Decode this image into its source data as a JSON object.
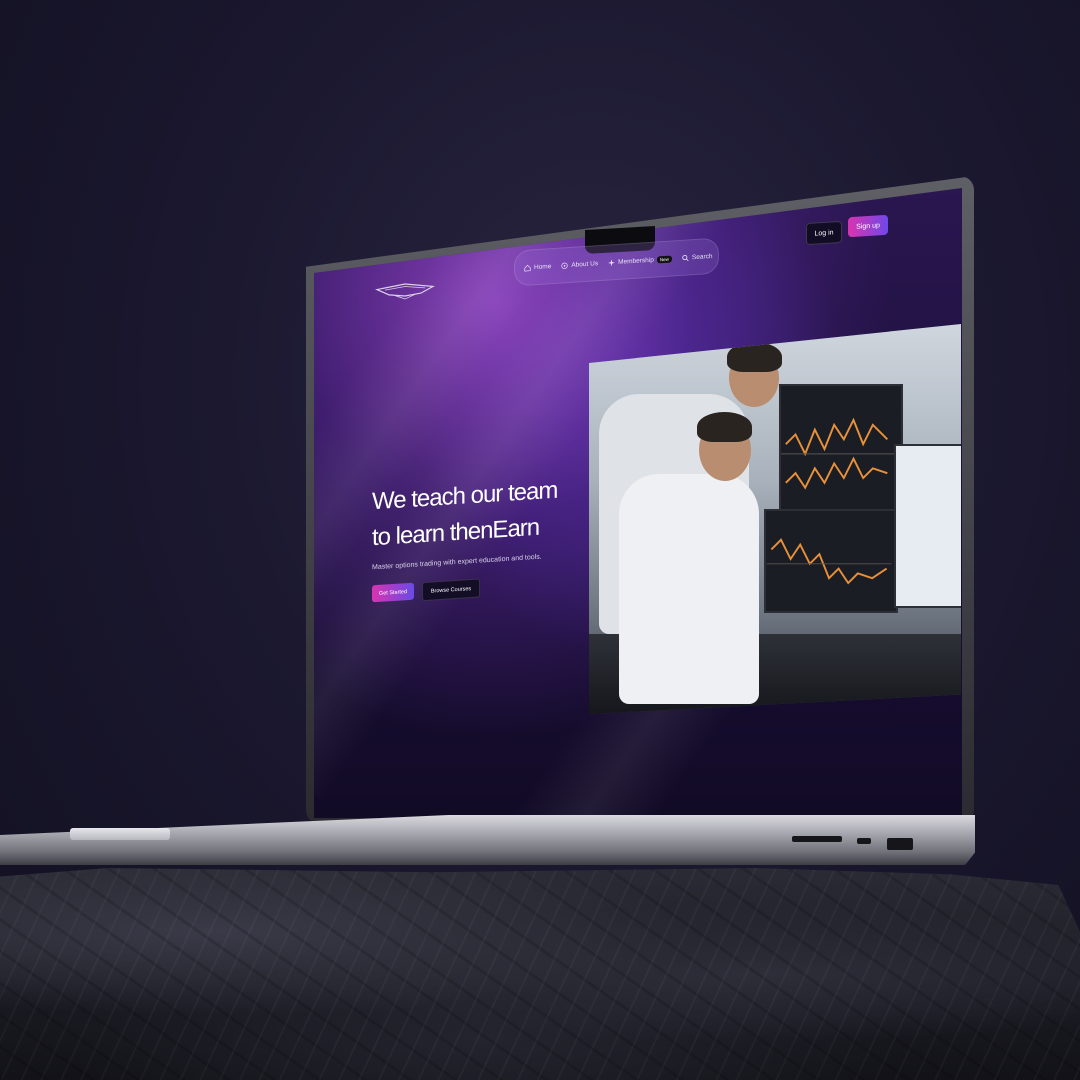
{
  "nav": {
    "items": [
      {
        "label": "Home",
        "icon": "home-icon"
      },
      {
        "label": "About Us",
        "icon": "info-icon"
      },
      {
        "label": "Membership",
        "icon": "sparkle-icon",
        "badge": "New"
      },
      {
        "label": "Search",
        "icon": "search-icon"
      }
    ]
  },
  "auth": {
    "login_label": "Log in",
    "signup_label": "Sign up"
  },
  "hero": {
    "title_line1": "We teach our team",
    "title_line2": "to learn thenEarn",
    "subtitle": "Master options trading with expert education and tools.",
    "primary_cta": "Get Started",
    "secondary_cta": "Browse Courses"
  },
  "colors": {
    "accent_start": "#d934b0",
    "accent_end": "#7048e8",
    "background": "#1a0f38"
  }
}
